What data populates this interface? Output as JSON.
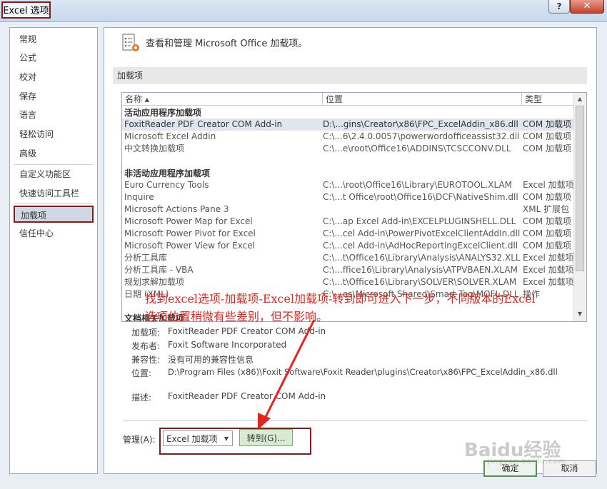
{
  "window": {
    "title": "Excel 选项",
    "help": "?",
    "close": "✕"
  },
  "nav": {
    "items": [
      "常规",
      "公式",
      "校对",
      "保存",
      "语言",
      "轻松访问",
      "高级",
      "自定义功能区",
      "快速访问工具栏",
      "加载项",
      "信任中心"
    ]
  },
  "header": {
    "text": "查看和管理 Microsoft Office 加载项。"
  },
  "section": {
    "title": "加载项"
  },
  "table": {
    "headers": [
      "名称 ▴",
      "位置",
      "类型"
    ],
    "groups": {
      "active": "活动应用程序加载项",
      "inactive": "非活动应用程序加载项",
      "docs": "文档相关加载项"
    },
    "active_rows": [
      [
        "FoxitReader PDF Creator COM Add-in",
        "D:\\...gins\\Creator\\x86\\FPC_ExcelAddin_x86.dll",
        "COM 加载项"
      ],
      [
        "Microsoft Excel Addin",
        "C:\\...6\\2.4.0.0057\\powerwordofficeassist32.dll",
        "COM 加载项"
      ],
      [
        "中文转换加载项",
        "C:\\...e\\root\\Office16\\ADDINS\\TCSCCONV.DLL",
        "COM 加载项"
      ]
    ],
    "inactive_rows": [
      [
        "Euro Currency Tools",
        "C:\\...\\root\\Office16\\Library\\EUROTOOL.XLAM",
        "Excel 加载项"
      ],
      [
        "Inquire",
        "C:\\...t Office\\root\\Office16\\DCF\\NativeShim.dll",
        "COM 加载项"
      ],
      [
        "Microsoft Actions Pane 3",
        "",
        "XML 扩展包"
      ],
      [
        "Microsoft Power Map for Excel",
        "C:\\...ap Excel Add-in\\EXCELPLUGINSHELL.DLL",
        "COM 加载项"
      ],
      [
        "Microsoft Power Pivot for Excel",
        "C:\\...cel Add-in\\PowerPivotExcelClientAddIn.dll",
        "COM 加载项"
      ],
      [
        "Microsoft Power View for Excel",
        "C:\\...cel Add-in\\AdHocReportingExcelClient.dll",
        "COM 加载项"
      ],
      [
        "分析工具库",
        "C:\\...t\\Office16\\Library\\Analysis\\ANALYS32.XLL",
        "Excel 加载项"
      ],
      [
        "分析工具库 - VBA",
        "C:\\...ffice16\\Library\\Analysis\\ATPVBAEN.XLAM",
        "Excel 加载项"
      ],
      [
        "规划求解加载项",
        "C:\\...t\\Office16\\Library\\SOLVER\\SOLVER.XLAM",
        "Excel 加载项"
      ],
      [
        "日期 (XML)",
        "C:\\...es\\Microsoft Shared\\Smart Tag\\MOFL.DLL",
        "操作"
      ]
    ]
  },
  "details": {
    "labels": [
      "加载项:",
      "发布者:",
      "兼容性:",
      "位置:",
      "描述:"
    ],
    "values": [
      "FoxitReader PDF Creator COM Add-in",
      "Foxit Software Incorporated",
      "没有可用的兼容性信息",
      "D:\\Program Files (x86)\\Foxit Software\\Foxit Reader\\plugins\\Creator\\x86\\FPC_ExcelAddin_x86.dll",
      "FoxitReader PDF Creator COM Add-in"
    ]
  },
  "manage": {
    "label": "管理(A):",
    "selected": "Excel 加载项",
    "go": "转到(G)..."
  },
  "buttons": {
    "ok": "确定",
    "cancel": "取消"
  },
  "annotation": {
    "line1": "找到excel选项-加载项-Excel加载项-转到即可进入下一步，不同版本的Excel",
    "line2": "选项位置稍微有些差别，但不影响。"
  },
  "watermark": {
    "brand": "Baidu经验",
    "url": "jingyan.baidu.com"
  },
  "colors": {
    "annotation": "#e8251c",
    "highlight_border": "#8b1a1a"
  }
}
